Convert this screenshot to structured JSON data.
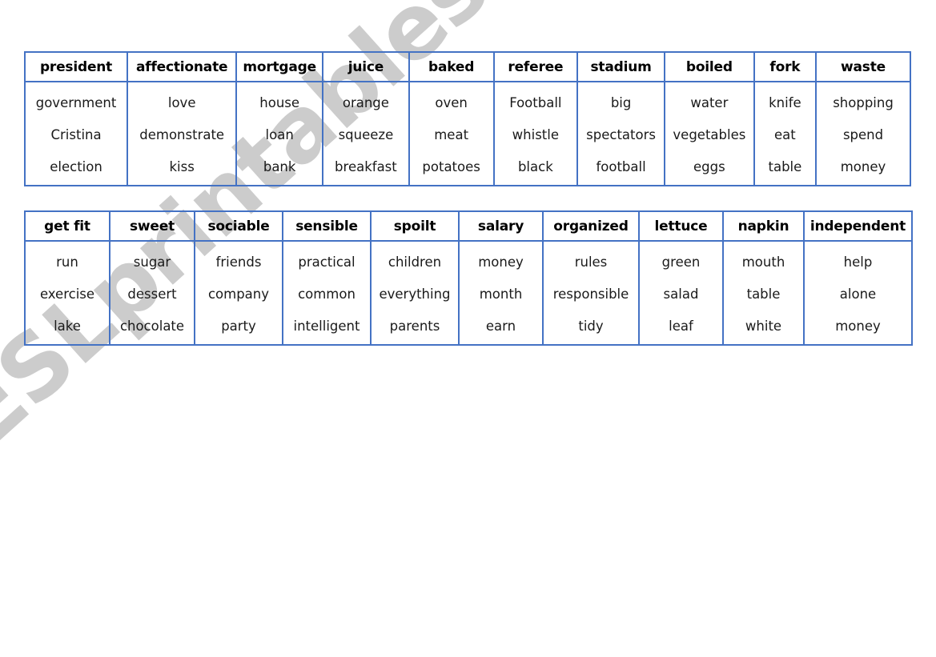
{
  "page": {
    "background_color": "#ffffff",
    "border_color": "#4472c4",
    "text_color": "#000000"
  },
  "watermark": {
    "text": "ESLprintables.com",
    "color": "#cccccc"
  },
  "tables": [
    {
      "id": "table-one",
      "name": "vocabulary-table-1",
      "columns": [
        {
          "header": "president",
          "words": [
            "government",
            "Cristina",
            "election"
          ]
        },
        {
          "header": "affectionate",
          "words": [
            "love",
            "demonstrate",
            "kiss"
          ]
        },
        {
          "header": "mortgage",
          "words": [
            "house",
            "loan",
            "bank"
          ]
        },
        {
          "header": "juice",
          "words": [
            "orange",
            "squeeze",
            "breakfast"
          ]
        },
        {
          "header": "baked",
          "words": [
            "oven",
            "meat",
            "potatoes"
          ]
        },
        {
          "header": "referee",
          "words": [
            "Football",
            "whistle",
            "black"
          ]
        },
        {
          "header": "stadium",
          "words": [
            "big",
            "spectators",
            "football"
          ]
        },
        {
          "header": "boiled",
          "words": [
            "water",
            "vegetables",
            "eggs"
          ]
        },
        {
          "header": "fork",
          "words": [
            "knife",
            "eat",
            "table"
          ]
        },
        {
          "header": "waste",
          "words": [
            "shopping",
            "spend",
            "money"
          ]
        }
      ]
    },
    {
      "id": "table-two",
      "name": "vocabulary-table-2",
      "columns": [
        {
          "header": "get fit",
          "words": [
            "run",
            "exercise",
            "lake"
          ]
        },
        {
          "header": "sweet",
          "words": [
            "sugar",
            "dessert",
            "chocolate"
          ]
        },
        {
          "header": "sociable",
          "words": [
            "friends",
            "company",
            "party"
          ]
        },
        {
          "header": "sensible",
          "words": [
            "practical",
            "common",
            "intelligent"
          ]
        },
        {
          "header": "spoilt",
          "words": [
            "children",
            "everything",
            "parents"
          ]
        },
        {
          "header": "salary",
          "words": [
            "money",
            "month",
            "earn"
          ]
        },
        {
          "header": "organized",
          "words": [
            "rules",
            "responsible",
            "tidy"
          ]
        },
        {
          "header": "lettuce",
          "words": [
            "green",
            "salad",
            "leaf"
          ]
        },
        {
          "header": "napkin",
          "words": [
            "mouth",
            "table",
            "white"
          ]
        },
        {
          "header": "independent",
          "words": [
            "help",
            "alone",
            "money"
          ]
        }
      ]
    }
  ]
}
